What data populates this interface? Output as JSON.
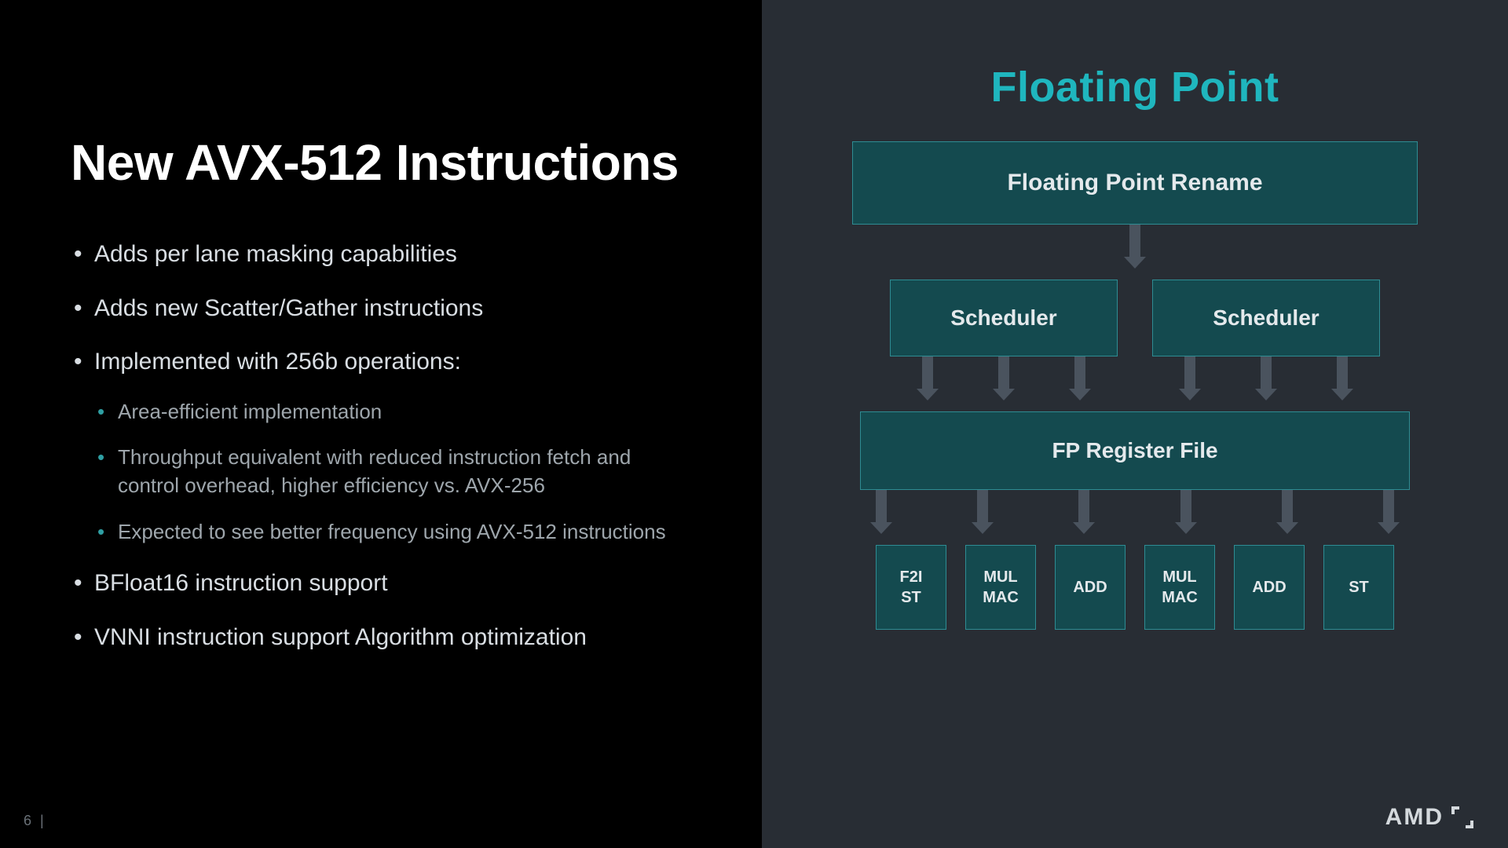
{
  "page_number": "6   |",
  "brand": "AMD",
  "left": {
    "title": "New AVX-512 Instructions",
    "bullets": [
      "Adds per lane masking capabilities",
      "Adds new Scatter/Gather instructions",
      "Implemented with 256b operations:",
      "BFloat16 instruction support",
      "VNNI instruction support Algorithm optimization"
    ],
    "sub_bullets": [
      "Area-efficient implementation",
      "Throughput equivalent with reduced instruction fetch and control overhead, higher efficiency vs. AVX-256",
      "Expected to see better frequency using AVX-512 instructions"
    ]
  },
  "diagram": {
    "title": "Floating Point",
    "rename": "Floating Point Rename",
    "sched1": "Scheduler",
    "sched2": "Scheduler",
    "regfile": "FP Register File",
    "units": [
      "F2I\nST",
      "MUL\nMAC",
      "ADD",
      "MUL\nMAC",
      "ADD",
      "ST"
    ]
  }
}
